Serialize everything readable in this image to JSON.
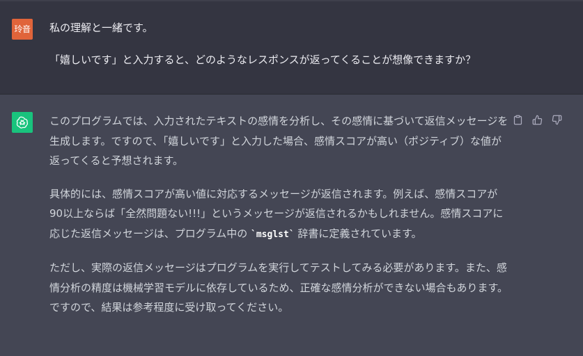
{
  "user": {
    "avatar_text": "玲音",
    "paragraphs": [
      "私の理解と一緒です。",
      "「嬉しいです」と入力すると、どのようなレスポンスが返ってくることが想像できますか？"
    ]
  },
  "assistant": {
    "avatar_icon": "openai-logo-icon",
    "p1": "このプログラムでは、入力されたテキストの感情を分析し、その感情に基づいて返信メッセージを生成します。ですので、「嬉しいです」と入力した場合、感情スコアが高い（ポジティブ）な値が返ってくると予想されます。",
    "p2_before": "具体的には、感情スコアが高い値に対応するメッセージが返信されます。例えば、感情スコアが90以上ならば「全然問題ない!!!」というメッセージが返信されるかもしれません。感情スコアに応じた返信メッセージは、プログラム中の ",
    "p2_code": "`msglst`",
    "p2_after": " 辞書に定義されています。",
    "p3": "ただし、実際の返信メッセージはプログラムを実行してテストしてみる必要があります。また、感情分析の精度は機械学習モデルに依存しているため、正確な感情分析ができない場合もあります。ですので、結果は参考程度に受け取ってください。"
  },
  "actions": [
    "copy-icon",
    "thumbs-up-icon",
    "thumbs-down-icon"
  ]
}
